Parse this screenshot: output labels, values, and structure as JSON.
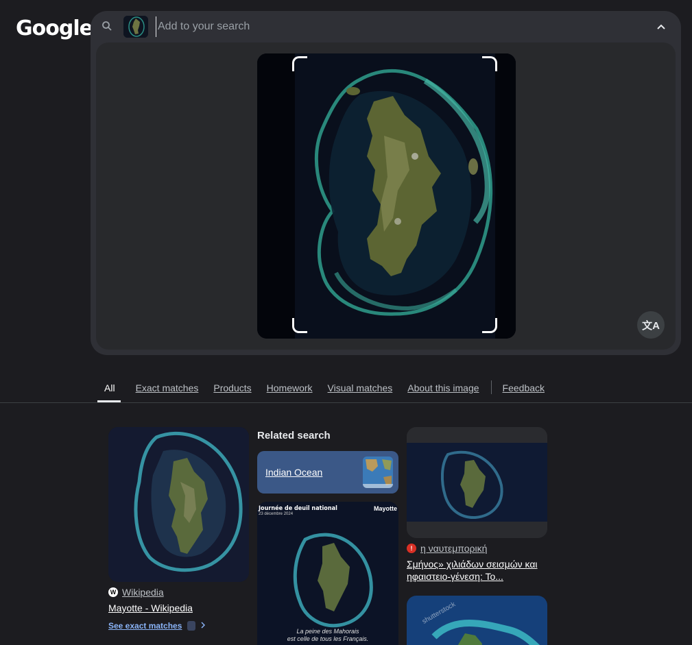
{
  "logo": {
    "text": "Google"
  },
  "search": {
    "placeholder": "Add to your search",
    "value": ""
  },
  "colors": {
    "background": "#1c1c20",
    "panel": "#2f3036",
    "link_blue": "#8ab4f8",
    "related_chip": "#3b5887"
  },
  "icons": {
    "search": "search-icon",
    "collapse": "chevron-up-icon",
    "translate": "translate-icon",
    "wikipedia": "wikipedia-icon",
    "source_red": "site-favicon-icon",
    "chevron_right": "chevron-right-icon"
  },
  "translate": {
    "glyph": "文A"
  },
  "tabs": [
    {
      "label": "All",
      "active": true
    },
    {
      "label": "Exact matches"
    },
    {
      "label": "Products"
    },
    {
      "label": "Homework"
    },
    {
      "label": "Visual matches"
    },
    {
      "label": "About this image"
    },
    {
      "label": "Feedback"
    }
  ],
  "results": {
    "card1": {
      "source": "Wikipedia",
      "title": "Mayotte - Wikipedia",
      "exact_link": "See exact matches"
    },
    "related": {
      "heading": "Related search",
      "chip_label": "Indian Ocean"
    },
    "poster": {
      "title": "Journée de deuil national",
      "date": "23 décembre 2024",
      "right": "Mayotte",
      "foot_line1": "La peine des Mahorais",
      "foot_line2": "est celle de tous les Français."
    },
    "card3": {
      "source": "η ναυτεμπορική",
      "title": "Σμήνος» χιλιάδων σεισμών και ηφαιστειο-γένεση: Το..."
    },
    "card4": {
      "watermark": "shutterstock"
    }
  }
}
